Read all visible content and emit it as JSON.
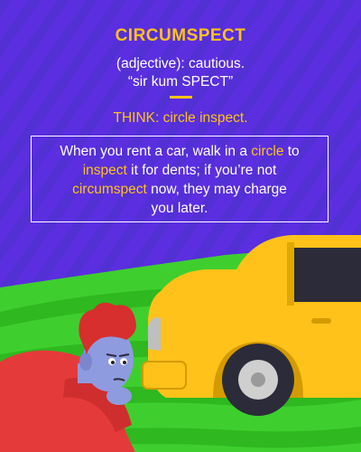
{
  "word": "CIRCUMSPECT",
  "definition": "(adjective): cautious.",
  "pronunciation": "“sir kum SPECT”",
  "think_label": "THINK:",
  "think_text": "circle inspect.",
  "sentence": {
    "p1": "When you rent a car, walk in a ",
    "h1": "circle",
    "p2": " to ",
    "h2": "inspect",
    "p3": " it for dents; if you’re not ",
    "h3": "circumspect",
    "p4": " now, they may charge you later."
  },
  "colors": {
    "background": "#5b2ee0",
    "accent": "#ffc21a",
    "text": "#ffffff",
    "grass": "#3ecf2e",
    "car": "#ffc21a"
  }
}
